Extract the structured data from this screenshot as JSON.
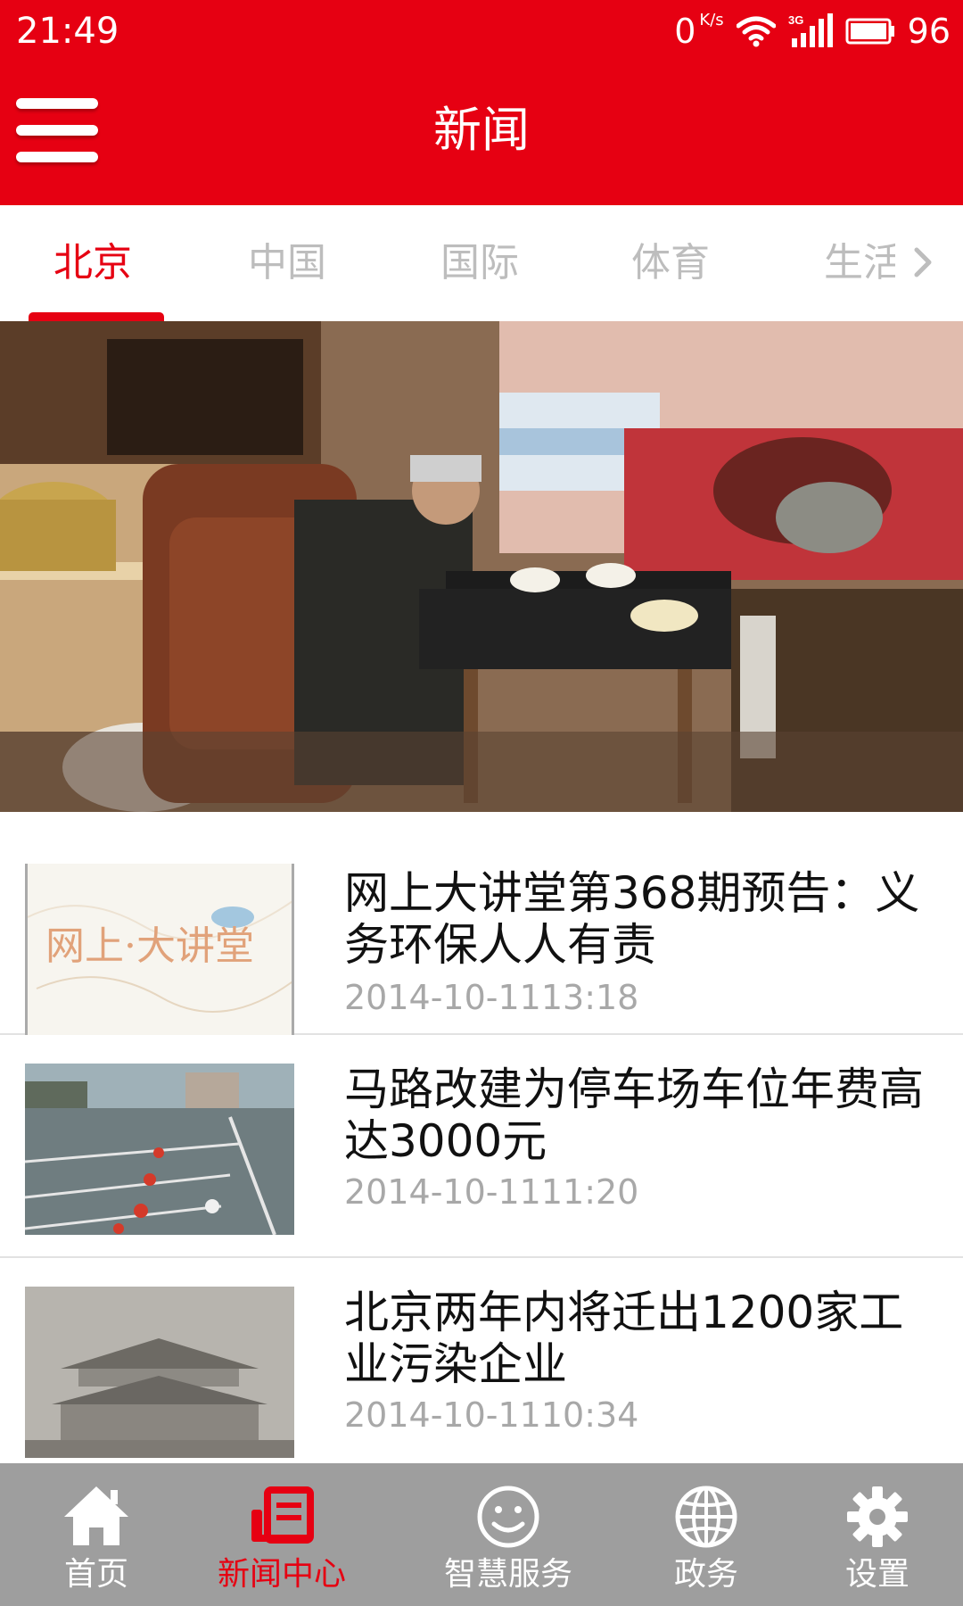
{
  "status_bar": {
    "time": "21:49",
    "network_speed": "0",
    "network_speed_unit": "K/s",
    "signal_type": "3G",
    "battery": "96"
  },
  "app_bar": {
    "title": "新闻",
    "menu_icon": "hamburger-menu-icon"
  },
  "tabs": [
    {
      "label": "北京",
      "active": true
    },
    {
      "label": "中国",
      "active": false
    },
    {
      "label": "国际",
      "active": false
    },
    {
      "label": "体育",
      "active": false
    },
    {
      "label": "生活",
      "active": false
    }
  ],
  "colors": {
    "accent": "#e60012",
    "tab_inactive": "#bdbdbd",
    "timestamp": "#a8a8a8",
    "bottom_bar": "#9e9e9e"
  },
  "news": [
    {
      "title": "网上大讲堂第368期预告：义务环保人人有责",
      "time": "2014-10-1113:18",
      "thumb_text": "网上·大讲堂"
    },
    {
      "title": "马路改建为停车场车位年费高达3000元",
      "time": "2014-10-1111:20"
    },
    {
      "title": "北京两年内将迁出1200家工业污染企业",
      "time": "2014-10-1110:34"
    }
  ],
  "bottom_nav": [
    {
      "label": "首页",
      "icon": "home-icon",
      "active": false
    },
    {
      "label": "新闻中心",
      "icon": "newspaper-icon",
      "active": true
    },
    {
      "label": "智慧服务",
      "icon": "smiley-icon",
      "active": false
    },
    {
      "label": "政务",
      "icon": "globe-icon",
      "active": false
    },
    {
      "label": "设置",
      "icon": "gear-icon",
      "active": false
    }
  ]
}
